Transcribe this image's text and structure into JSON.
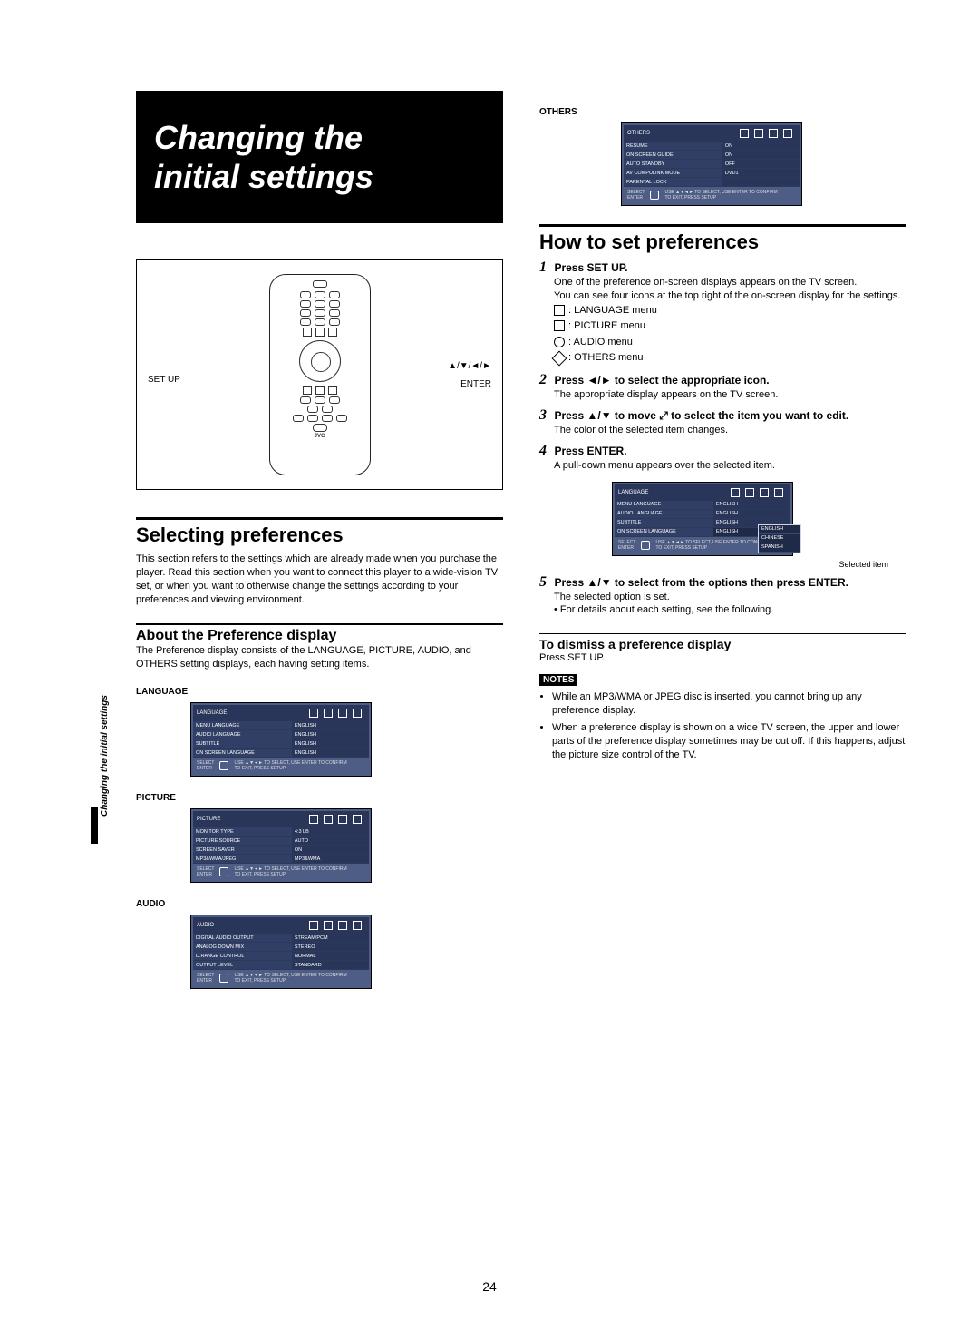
{
  "page_number": "24",
  "side_tab": "Changing the initial settings",
  "title_line1": "Changing the",
  "title_line2": "initial settings",
  "remote": {
    "setup": "SET UP",
    "enter": "ENTER",
    "arrows": "▲/▼/◄/►",
    "brand": "JVC"
  },
  "left": {
    "selecting_heading": "Selecting preferences",
    "selecting_body": "This section refers to the settings which are already made when you purchase the player. Read this section when you want to connect this player to a wide-vision TV set, or when you want to otherwise change the settings according to your preferences and viewing environment.",
    "about_heading": "About the Preference display",
    "about_body": "The Preference display consists of the LANGUAGE, PICTURE, AUDIO, and OTHERS setting displays, each having setting items.",
    "labels": {
      "language": "LANGUAGE",
      "picture": "PICTURE",
      "audio": "AUDIO"
    },
    "menus": {
      "footer_select": "SELECT",
      "footer_enter": "ENTER",
      "footer_hint1": "USE ▲▼◄► TO SELECT, USE ENTER TO CONFIRM",
      "footer_hint2": "TO EXIT, PRESS SETUP",
      "language": {
        "name": "LANGUAGE",
        "rows": [
          {
            "l": "MENU LANGUAGE",
            "r": "ENGLISH"
          },
          {
            "l": "AUDIO LANGUAGE",
            "r": "ENGLISH"
          },
          {
            "l": "SUBTITLE",
            "r": "ENGLISH"
          },
          {
            "l": "ON SCREEN LANGUAGE",
            "r": "ENGLISH"
          }
        ]
      },
      "picture": {
        "name": "PICTURE",
        "rows": [
          {
            "l": "MONITOR TYPE",
            "r": "4:3 LB"
          },
          {
            "l": "PICTURE SOURCE",
            "r": "AUTO"
          },
          {
            "l": "SCREEN SAVER",
            "r": "ON"
          },
          {
            "l": "MP3&WMA/JPEG",
            "r": "MP3&WMA"
          }
        ]
      },
      "audio": {
        "name": "AUDIO",
        "rows": [
          {
            "l": "DIGITAL AUDIO OUTPUT",
            "r": "STREAM/PCM"
          },
          {
            "l": "ANALOG DOWN MIX",
            "r": "STEREO"
          },
          {
            "l": "D.RANGE CONTROL",
            "r": "NORMAL"
          },
          {
            "l": "OUTPUT LEVEL",
            "r": "STANDARD"
          }
        ]
      }
    }
  },
  "right": {
    "others_label": "OTHERS",
    "others_menu": {
      "name": "OTHERS",
      "rows": [
        {
          "l": "RESUME",
          "r": "ON"
        },
        {
          "l": "ON SCREEN GUIDE",
          "r": "ON"
        },
        {
          "l": "AUTO STANDBY",
          "r": "OFF"
        },
        {
          "l": "AV COMPULINK MODE",
          "r": "DVD1"
        },
        {
          "l": "PARENTAL LOCK",
          "r": ""
        }
      ]
    },
    "how_heading": "How to set preferences",
    "steps": {
      "s1_t": "Press SET UP.",
      "s1_d1": "One of the preference on-screen displays appears on the TV screen.",
      "s1_d2": "You can see four icons at the top right of the on-screen display for the settings.",
      "icon_lang": ": LANGUAGE menu",
      "icon_pic": ": PICTURE menu",
      "icon_aud": ": AUDIO menu",
      "icon_oth": ": OTHERS menu",
      "s2_t": "Press ◄/► to select the appropriate icon.",
      "s2_d": "The appropriate display appears on the TV screen.",
      "s3_t": "Press ▲/▼ to move  ⤢  to select the item you want to edit.",
      "s3_d": "The color of the selected item changes.",
      "s4_t": "Press ENTER.",
      "s4_d": "A pull-down menu appears over the selected item.",
      "ddl_caption": "Selected item",
      "ddl_rows": [
        {
          "l": "MENU LANGUAGE",
          "r": "ENGLISH"
        },
        {
          "l": "AUDIO LANGUAGE",
          "r": "ENGLISH"
        },
        {
          "l": "SUBTITLE",
          "r": "ENGLISH"
        },
        {
          "l": "ON SCREEN LANGUAGE",
          "r": "ENGLISH"
        }
      ],
      "ddl_opts": [
        "ENGLISH",
        "CHINESE",
        "SPANISH"
      ],
      "s5_t": "Press ▲/▼ to select from the options then press ENTER.",
      "s5_d1": "The selected option is set.",
      "s5_d2": "• For details about each setting, see the following.",
      "dismiss_h": "To dismiss a preference display",
      "dismiss_d": "Press SET UP."
    },
    "notes_label": "NOTES",
    "notes": [
      "While an MP3/WMA or JPEG disc is inserted, you cannot bring up any preference display.",
      "When a preference display is shown on a wide TV screen, the upper and lower parts of the preference display sometimes may be cut off. If this happens, adjust the picture size control of the TV."
    ]
  }
}
